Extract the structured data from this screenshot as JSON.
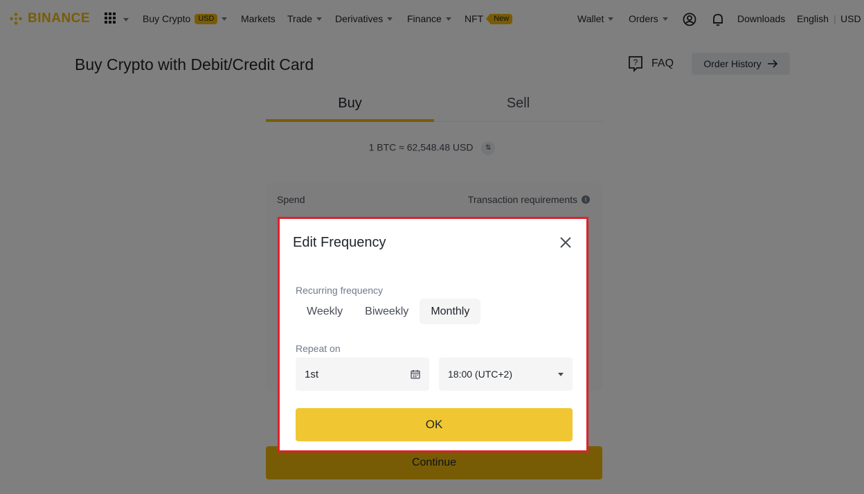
{
  "nav": {
    "brand": "BINANCE",
    "items": [
      {
        "label": "Buy Crypto",
        "badge": "USD"
      },
      {
        "label": "Markets"
      },
      {
        "label": "Trade"
      },
      {
        "label": "Derivatives"
      },
      {
        "label": "Finance"
      },
      {
        "label": "NFT",
        "badge": "New"
      }
    ],
    "right": {
      "wallet": "Wallet",
      "orders": "Orders",
      "downloads": "Downloads",
      "language": "English",
      "currency": "USD"
    },
    "icons": [
      "grid-menu-icon",
      "user-icon",
      "bell-icon"
    ],
    "accent_color": "#f0b90b"
  },
  "page": {
    "title": "Buy Crypto with Debit/Credit Card",
    "faq": "FAQ",
    "order_history": "Order History",
    "tabs": [
      "Buy",
      "Sell"
    ],
    "active_tab": "Buy",
    "rate": "1 BTC ≈ 62,548.48 USD",
    "form": {
      "spend_label": "Spend",
      "transaction_requirements": "Transaction requirements"
    },
    "continue": "Continue"
  },
  "modal": {
    "title": "Edit Frequency",
    "recurring_label": "Recurring frequency",
    "options": [
      "Weekly",
      "Biweekly",
      "Monthly"
    ],
    "selected_option": "Monthly",
    "repeat_label": "Repeat on",
    "day_value": "1st",
    "time_value": "18:00 (UTC+2)",
    "ok": "OK",
    "highlight_color": "#e0202a"
  }
}
